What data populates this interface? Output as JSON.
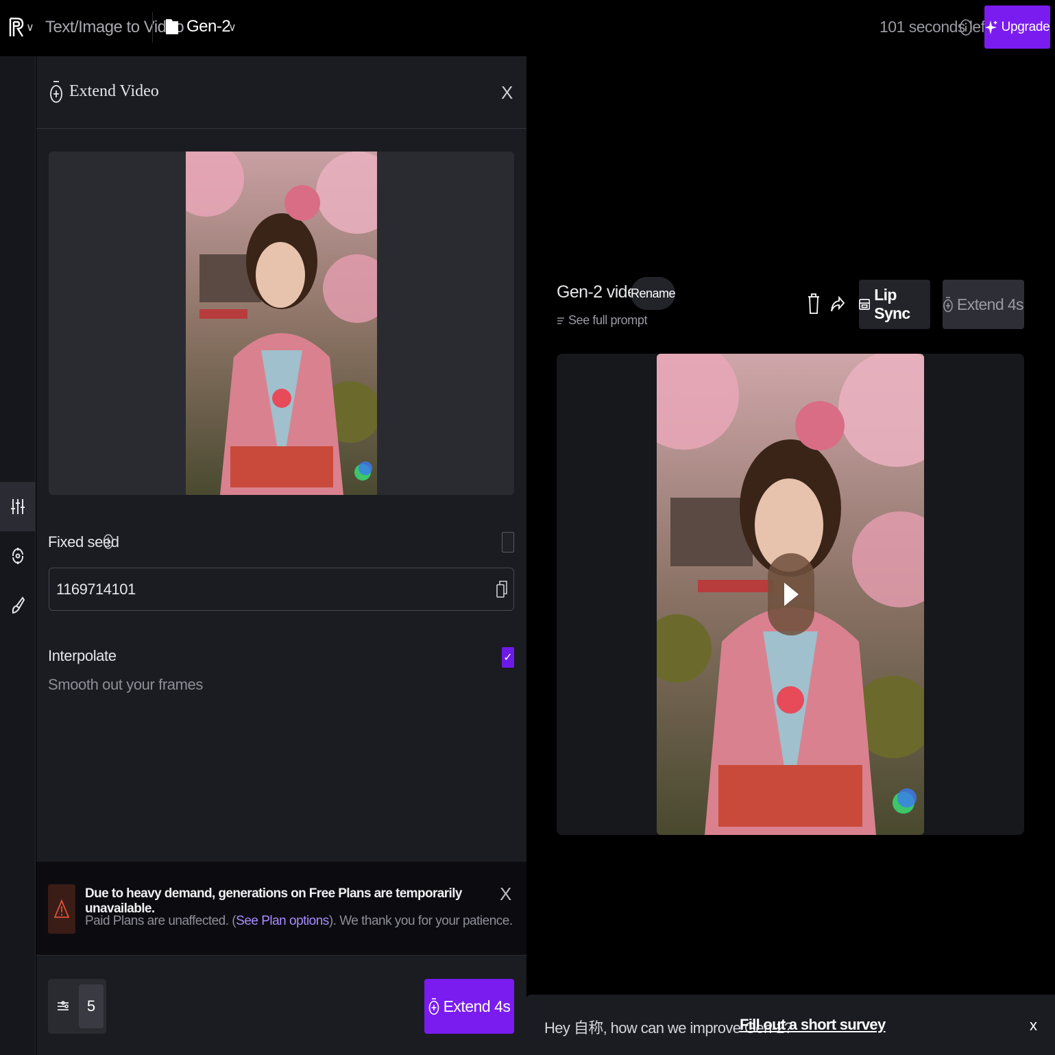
{
  "topbar": {
    "mode_label": "Text/Image to Video",
    "project_name": "Gen-2",
    "seconds_left": "101 seconds left",
    "upgrade_label": "Upgrade"
  },
  "rail": {
    "items": [
      {
        "icon": "sliders-icon",
        "active": true
      },
      {
        "icon": "motion-icon",
        "active": false
      },
      {
        "icon": "brush-icon",
        "active": false
      }
    ]
  },
  "panel": {
    "title": "Extend Video",
    "close_label": "X",
    "fixed_seed_label": "Fixed seed",
    "fixed_seed_checked": false,
    "seed_value": "1169714101",
    "interpolate_label": "Interpolate",
    "interpolate_sub": "Smooth out your frames",
    "interpolate_checked": true
  },
  "alert": {
    "title": "Due to heavy demand, generations on Free Plans are temporarily unavailable.",
    "body_before": "Paid Plans are unaffected. (",
    "body_link": "See Plan options",
    "body_after": "). We thank you for your patience.",
    "close_label": "X"
  },
  "footer": {
    "count": "5",
    "extend_label": "Extend 4s"
  },
  "video": {
    "title": "Gen-2 video",
    "rename_label": "Rename",
    "full_prompt_label": "See full prompt",
    "lipsync_label": "Lip Sync",
    "extend_label": "Extend 4s"
  },
  "survey": {
    "text": "Hey 自称, how can we improve Gen-2?",
    "link": "Fill out a short survey",
    "close_label": "x"
  },
  "colors": {
    "accent": "#7a1cf0",
    "background": "#000000",
    "panel": "#1b1c22"
  }
}
